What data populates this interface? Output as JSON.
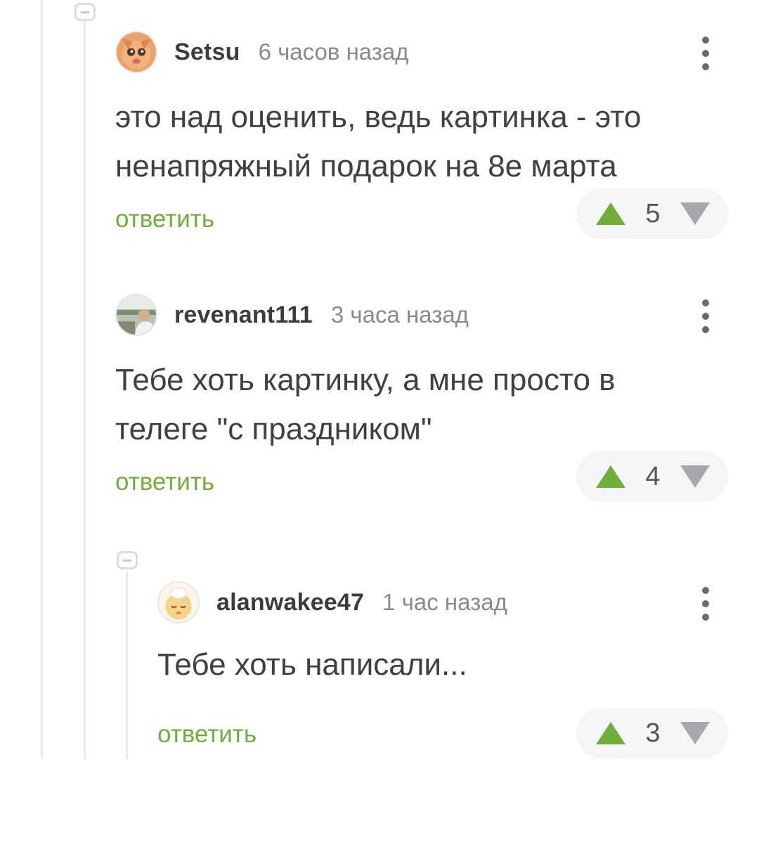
{
  "comments": [
    {
      "author": "Setsu",
      "time": "6 часов назад",
      "text": "это над оценить, ведь картинка - это ненапряжный подарок на 8е марта",
      "reply_label": "ответить",
      "rating": "5",
      "avatar_icon": "cat-avatar"
    },
    {
      "author": "revenant111",
      "time": "3 часа назад",
      "text": "Тебе хоть картинку, а мне просто в телеге \"с праздником\"",
      "reply_label": "ответить",
      "rating": "4",
      "avatar_icon": "person-avatar"
    },
    {
      "author": "alanwakee47",
      "time": "1 час назад",
      "text": "Тебе хоть написали...",
      "reply_label": "ответить",
      "rating": "3",
      "avatar_icon": "sleepy-face-avatar"
    }
  ],
  "colors": {
    "accent_green": "#70ad3b",
    "downvote_gray": "#a8a8ac",
    "thread_line": "#e8e8ea"
  }
}
